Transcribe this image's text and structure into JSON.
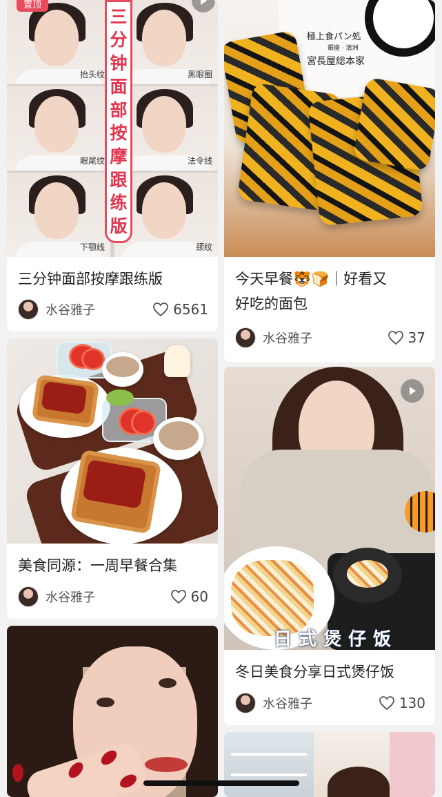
{
  "feed": {
    "left": [
      {
        "title": "三分钟面部按摩跟练版",
        "author": "水谷雅子",
        "likes": "6561",
        "banner_text": "三分钟面部按摩跟练版",
        "tag": "置顶",
        "labels": [
          "抬头纹",
          "黑眼圈",
          "眼尾纹",
          "法令线",
          "下颚线",
          "颈纹"
        ]
      },
      {
        "title": "美食同源：一周早餐合集",
        "author": "水谷雅子",
        "likes": "60"
      },
      {
        "title": "",
        "author": "",
        "likes": ""
      }
    ],
    "right": [
      {
        "title_line1": "今天早餐🐯🍞｜好看又",
        "title_line2": "好吃的面包",
        "author": "水谷雅子",
        "likes": "37",
        "sign_line1": "極上食パン処",
        "sign_line2": "銀座 · 清洲",
        "sign_line3": "宮長屋総本家"
      },
      {
        "title": "冬日美食分享日式煲仔饭",
        "author": "水谷雅子",
        "likes": "130",
        "overlay": "日式煲仔饭"
      }
    ]
  },
  "colors": {
    "accent_red": "#e84b5d",
    "card_bg": "#ffffff",
    "page_bg": "#f2f2f2"
  },
  "icons": {
    "like": "heart-outline-icon",
    "play": "play-icon"
  }
}
